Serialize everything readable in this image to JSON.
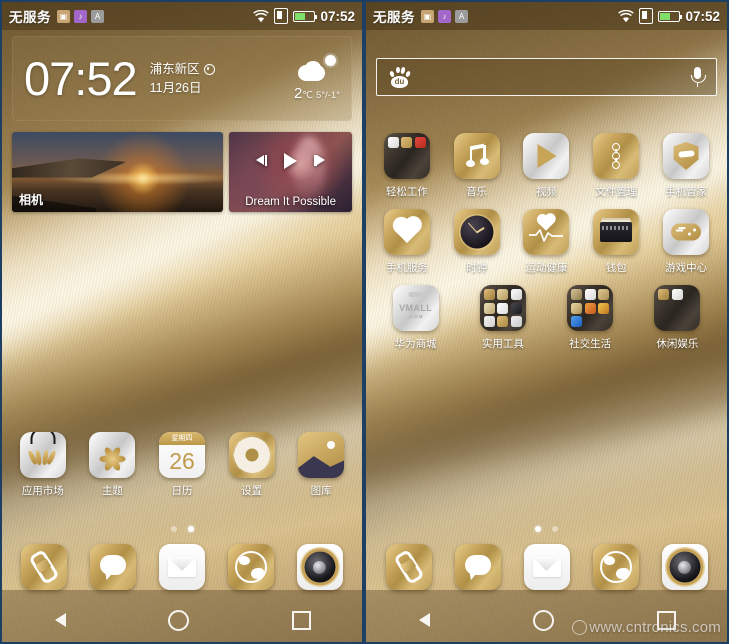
{
  "screens": {
    "left": {
      "status": {
        "carrier": "无服务",
        "notif_icons": [
          "notification-icon-1",
          "notification-icon-2",
          "notification-icon-3"
        ],
        "wifi": "wifi-icon",
        "sim": "sim-icon",
        "battery": "battery-charging-icon",
        "time": "07:52"
      },
      "clock_widget": {
        "time": "07:52",
        "location": "浦东新区",
        "date": "11月26日",
        "weather_icon": "partly-cloudy-icon",
        "temp": "2",
        "temp_unit": "℃",
        "range": "5°/-1°"
      },
      "cards": [
        {
          "name": "camera-card",
          "label": "相机"
        },
        {
          "name": "music-card",
          "label": "Dream It Possible",
          "controls": [
            "previous-icon",
            "play-icon",
            "next-icon"
          ]
        }
      ],
      "apps": [
        {
          "label": "应用市场",
          "icon": "app-market-icon"
        },
        {
          "label": "主题",
          "icon": "themes-icon"
        },
        {
          "label": "日历",
          "icon": "calendar-icon",
          "weekday": "星期四",
          "day": "26"
        },
        {
          "label": "设置",
          "icon": "settings-gear-icon"
        },
        {
          "label": "图库",
          "icon": "gallery-icon"
        }
      ],
      "page_dots": {
        "count": 2,
        "active": 1
      }
    },
    "right": {
      "status": {
        "carrier": "无服务",
        "notif_icons": [
          "notification-icon-1",
          "notification-icon-2",
          "notification-icon-3"
        ],
        "wifi": "wifi-icon",
        "sim": "sim-icon",
        "battery": "battery-charging-icon",
        "time": "07:52"
      },
      "search": {
        "logo": "baidu-paw-icon",
        "logo_text": "du",
        "value": "",
        "placeholder": "",
        "mic": "microphone-icon"
      },
      "apps_row1": [
        {
          "label": "轻松工作",
          "icon": "folder-icon"
        },
        {
          "label": "音乐",
          "icon": "music-note-icon"
        },
        {
          "label": "视频",
          "icon": "video-play-icon"
        },
        {
          "label": "文件管理",
          "icon": "file-manager-icon"
        },
        {
          "label": "手机管家",
          "icon": "phone-manager-shield-icon"
        }
      ],
      "apps_row2": [
        {
          "label": "手机服务",
          "icon": "phone-service-heart-icon"
        },
        {
          "label": "时钟",
          "icon": "clock-icon"
        },
        {
          "label": "运动健康",
          "icon": "health-ecg-icon"
        },
        {
          "label": "钱包",
          "icon": "wallet-icon"
        },
        {
          "label": "游戏中心",
          "icon": "game-center-icon"
        }
      ],
      "apps_row3": [
        {
          "label": "华为商城",
          "icon": "vmall-icon",
          "icon_text": "VMALL",
          "icon_subtext": ".COM"
        },
        {
          "label": "实用工具",
          "icon": "folder-icon"
        },
        {
          "label": "社交生活",
          "icon": "folder-icon"
        },
        {
          "label": "休闲娱乐",
          "icon": "folder-icon"
        }
      ],
      "page_dots": {
        "count": 2,
        "active": 0
      }
    }
  },
  "dock": [
    {
      "label": "phone",
      "icon": "phone-icon"
    },
    {
      "label": "messages",
      "icon": "message-bubble-icon"
    },
    {
      "label": "email",
      "icon": "envelope-icon"
    },
    {
      "label": "browser",
      "icon": "globe-icon"
    },
    {
      "label": "camera",
      "icon": "camera-lens-icon"
    }
  ],
  "navbar": [
    {
      "name": "back-icon"
    },
    {
      "name": "home-icon"
    },
    {
      "name": "recents-icon"
    }
  ],
  "watermark": "www.cntronics.com",
  "colors": {
    "accent_gold": "#c9a75e",
    "wallpaper_dark": "#6f5830",
    "battery_green": "#7ee06a"
  }
}
